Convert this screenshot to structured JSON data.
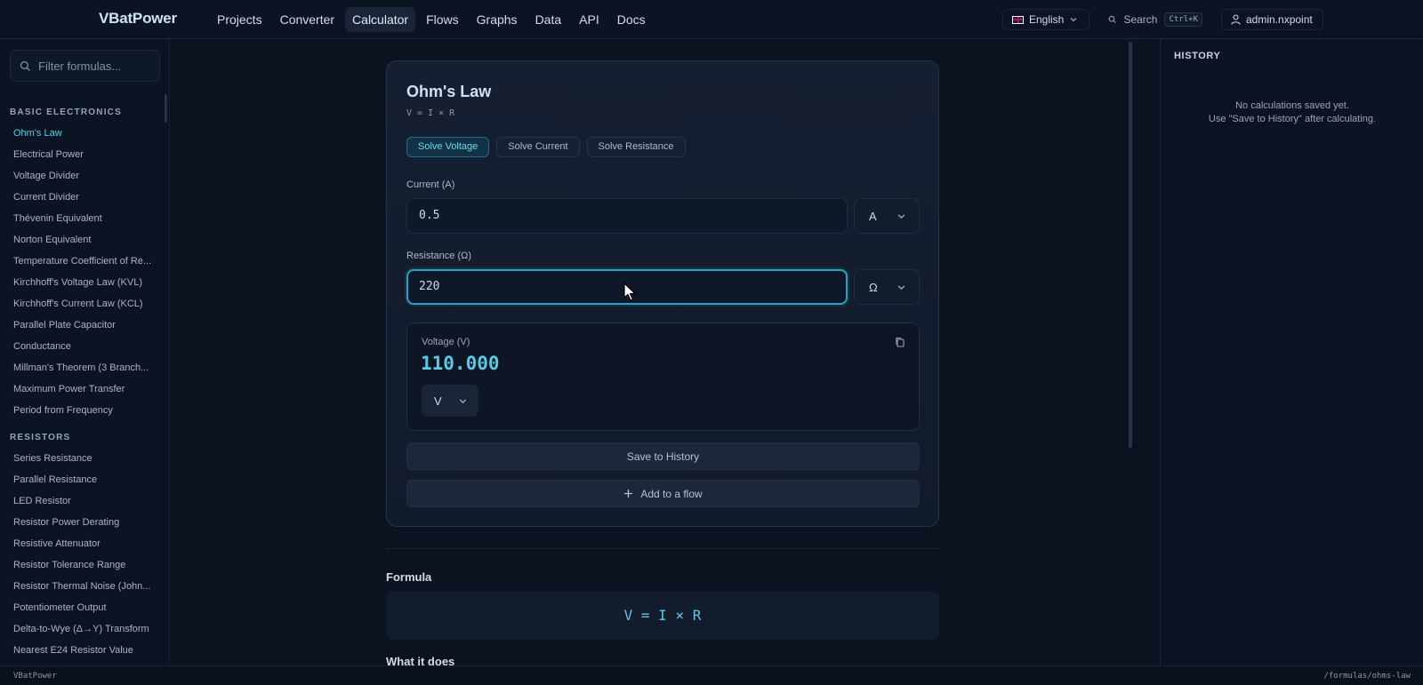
{
  "app": {
    "brand": "VBatPower",
    "nav": [
      "Projects",
      "Converter",
      "Calculator",
      "Flows",
      "Graphs",
      "Data",
      "API",
      "Docs"
    ],
    "active_nav": "Calculator",
    "language": "English",
    "search_label": "Search",
    "search_shortcut": "Ctrl+K",
    "user": "admin.nxpoint"
  },
  "sidebar": {
    "filter_placeholder": "Filter formulas...",
    "groups": [
      {
        "title": "BASIC ELECTRONICS",
        "items": [
          "Ohm's Law",
          "Electrical Power",
          "Voltage Divider",
          "Current Divider",
          "Thévenin Equivalent",
          "Norton Equivalent",
          "Temperature Coefficient of Re...",
          "Kirchhoff's Voltage Law (KVL)",
          "Kirchhoff's Current Law (KCL)",
          "Parallel Plate Capacitor",
          "Conductance",
          "Millman's Theorem (3 Branch...",
          "Maximum Power Transfer",
          "Period from Frequency"
        ]
      },
      {
        "title": "RESISTORS",
        "items": [
          "Series Resistance",
          "Parallel Resistance",
          "LED Resistor",
          "Resistor Power Derating",
          "Resistive Attenuator",
          "Resistor Tolerance Range",
          "Resistor Thermal Noise (John...",
          "Potentiometer Output",
          "Delta-to-Wye (Δ→Y) Transform",
          "Nearest E24 Resistor Value"
        ]
      }
    ],
    "active_item": "Ohm's Law"
  },
  "calculator": {
    "title": "Ohm's Law",
    "formula": "V = I × R",
    "tabs": [
      "Solve Voltage",
      "Solve Current",
      "Solve Resistance"
    ],
    "active_tab": "Solve Voltage",
    "current": {
      "label": "Current (A)",
      "value": "0.5",
      "unit": "A"
    },
    "resistance": {
      "label": "Resistance (Ω)",
      "value": "220",
      "unit": "Ω"
    },
    "result": {
      "label": "Voltage (V)",
      "value": "110.000",
      "unit": "V"
    },
    "save_button": "Save to History",
    "flow_button": "Add to a flow",
    "formula_section_title": "Formula",
    "formula_display": "V = I × R",
    "what_it_does_title": "What it does"
  },
  "history": {
    "title": "HISTORY",
    "empty_line1": "No calculations saved yet.",
    "empty_line2": "Use \"Save to History\" after calculating."
  },
  "statusbar": {
    "left": "VBatPower",
    "right": "/formulas/ohms-law"
  },
  "colors": {
    "accent": "#5cc8e2",
    "background": "#0b1220",
    "focus_border": "#2aa2bd"
  }
}
